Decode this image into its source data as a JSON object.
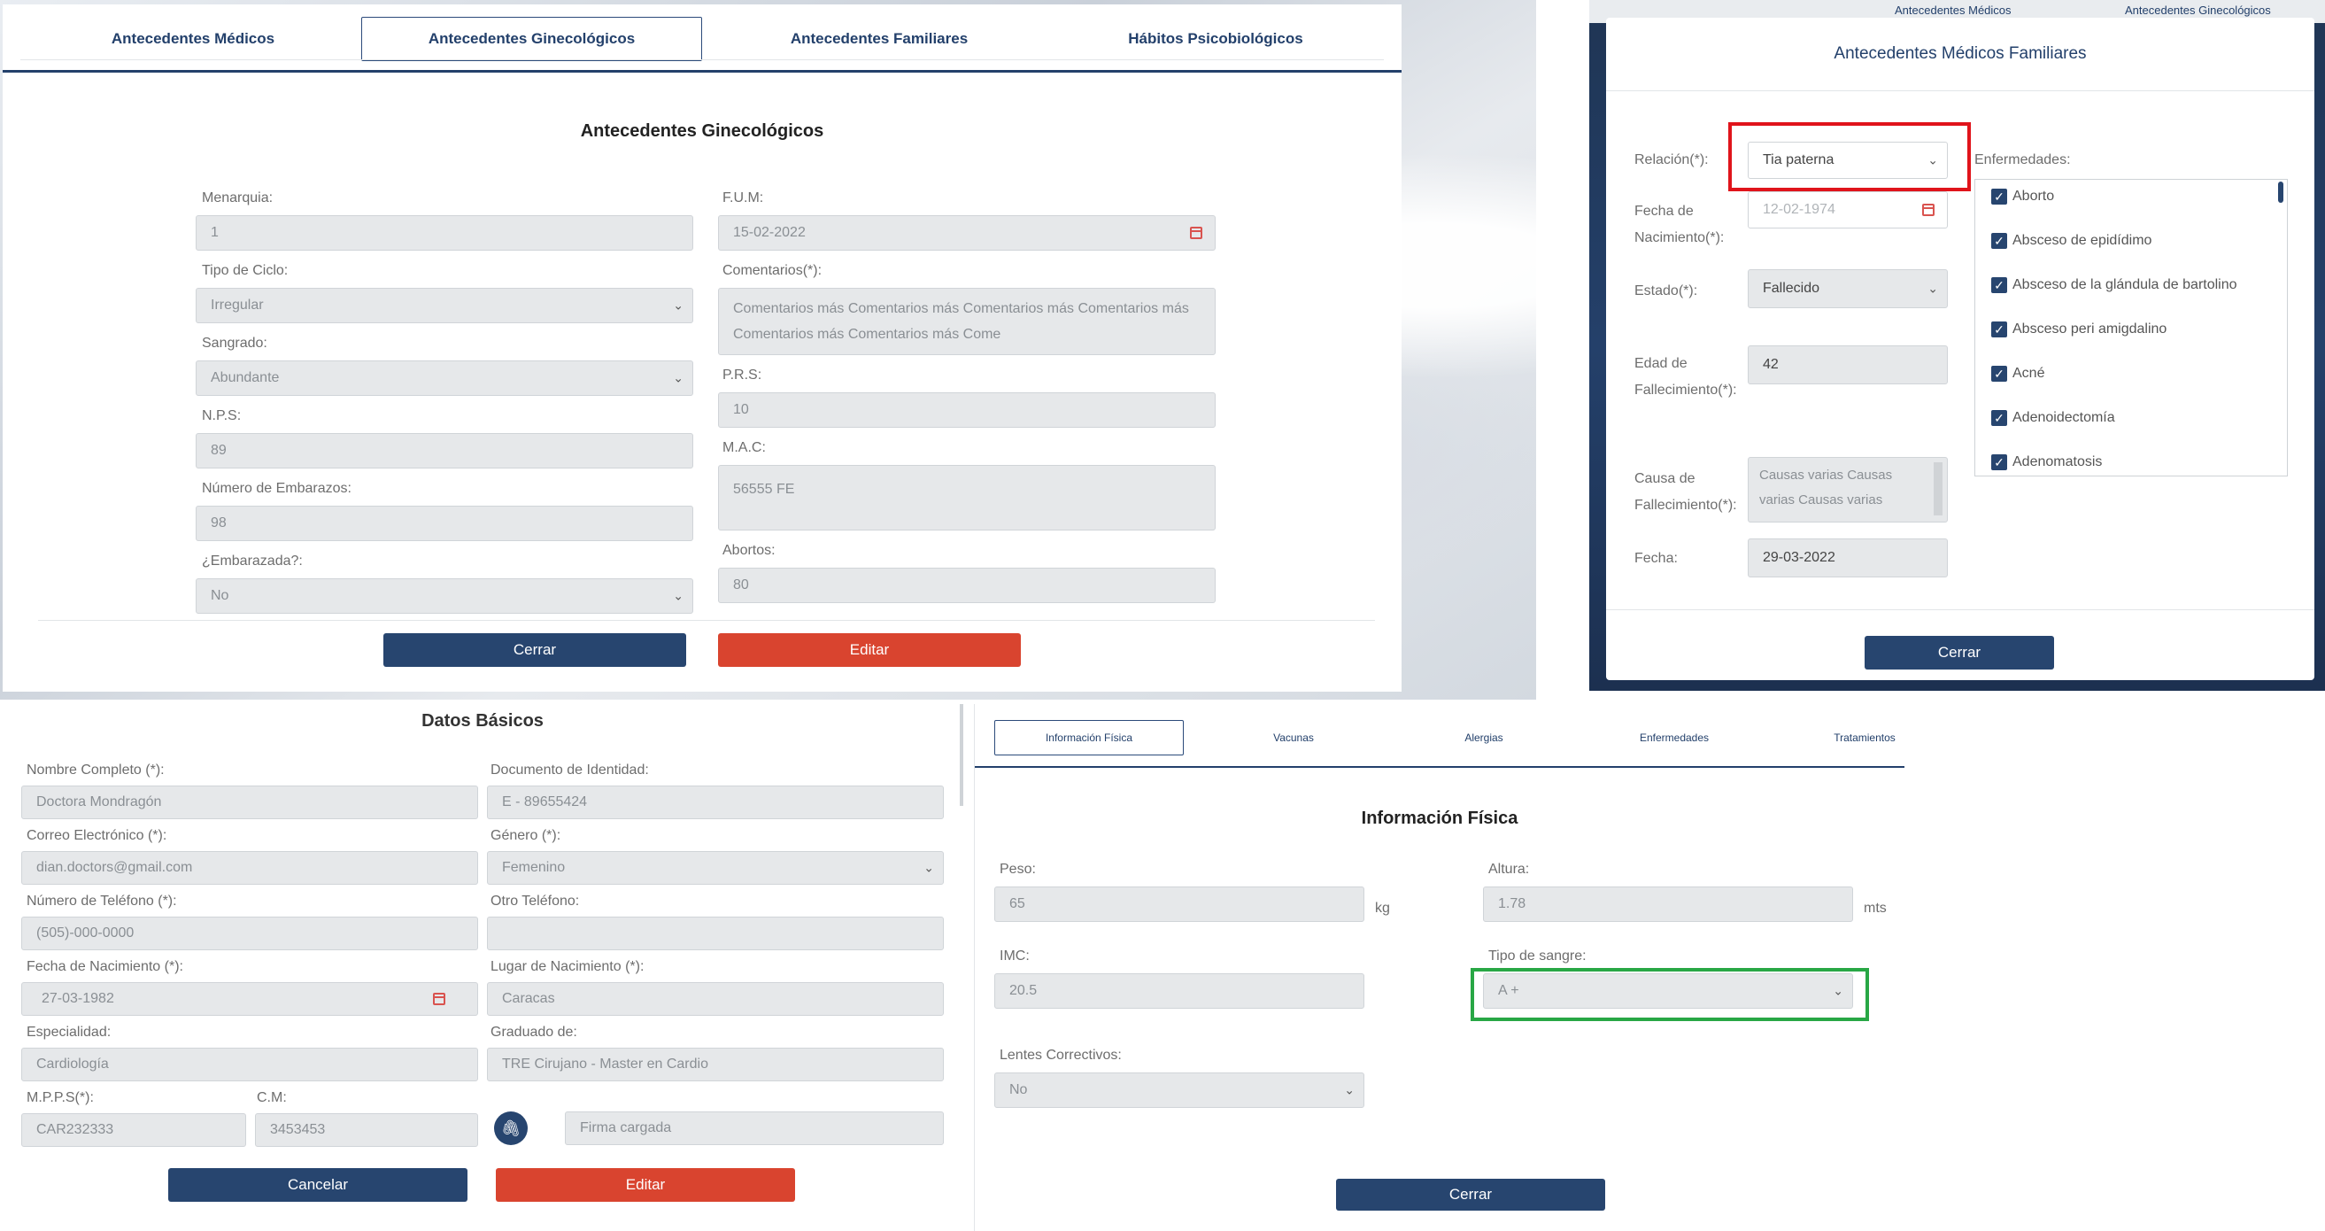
{
  "gyn": {
    "tabs": [
      "Antecedentes Médicos",
      "Antecedentes Ginecológicos",
      "Antecedentes Familiares",
      "Hábitos Psicobiológicos"
    ],
    "title": "Antecedentes Ginecológicos",
    "menarquia": {
      "label": "Menarquia:",
      "value": "1"
    },
    "fum": {
      "label": "F.U.M:",
      "value": "15-02-2022"
    },
    "tipo_ciclo": {
      "label": "Tipo de Ciclo:",
      "value": "Irregular"
    },
    "comentarios": {
      "label": "Comentarios(*):",
      "value": "Comentarios más Comentarios más Comentarios más Comentarios más Comentarios más Comentarios más Come"
    },
    "sangrado": {
      "label": "Sangrado:",
      "value": "Abundante"
    },
    "prs": {
      "label": "P.R.S:",
      "value": "10"
    },
    "nps": {
      "label": "N.P.S:",
      "value": "89"
    },
    "mac": {
      "label": "M.A.C:",
      "value": "56555 FE"
    },
    "num_embarazos": {
      "label": "Número de Embarazos:",
      "value": "98"
    },
    "abortos": {
      "label": "Abortos:",
      "value": "80"
    },
    "embarazada": {
      "label": "¿Embarazada?:",
      "value": "No"
    },
    "cerrar": "Cerrar",
    "editar": "Editar"
  },
  "fam": {
    "title": "Antecedentes Médicos Familiares",
    "bg_tabs": [
      "Antecedentes Médicos",
      "Antecedentes Ginecológicos"
    ],
    "relacion": {
      "label": "Relación(*):",
      "value": "Tia paterna"
    },
    "fecha_nac": {
      "label1": "Fecha de",
      "label2": "Nacimiento(*):",
      "value": "12-02-1974"
    },
    "estado": {
      "label": "Estado(*):",
      "value": "Fallecido"
    },
    "edad": {
      "label1": "Edad de",
      "label2": "Fallecimiento(*):",
      "value": "42"
    },
    "causa": {
      "label1": "Causa de",
      "label2": "Fallecimiento(*):",
      "value": "Causas varias Causas varias Causas varias"
    },
    "fecha": {
      "label": "Fecha:",
      "value": "29-03-2022"
    },
    "enfermedades_label": "Enfermedades:",
    "enfermedades": [
      "Aborto",
      "Absceso de epidídimo",
      "Absceso de la glándula de bartolino",
      "Absceso peri amigdalino",
      "Acné",
      "Adenoidectomía",
      "Adenomatosis"
    ],
    "cerrar": "Cerrar"
  },
  "basic": {
    "title": "Datos Básicos",
    "nombre": {
      "label": "Nombre Completo (*):",
      "value": "Doctora Mondragón"
    },
    "documento": {
      "label": "Documento de Identidad:",
      "value": "E - 89655424"
    },
    "correo": {
      "label": "Correo Electrónico (*):",
      "value": "dian.doctors@gmail.com"
    },
    "genero": {
      "label": "Género (*):",
      "value": "Femenino"
    },
    "telefono": {
      "label": "Número de Teléfono (*):",
      "value": "(505)-000-0000"
    },
    "otro_tel": {
      "label": "Otro Teléfono:",
      "value": ""
    },
    "fecha_nac": {
      "label": "Fecha de Nacimiento (*):",
      "value": "27-03-1982"
    },
    "lugar_nac": {
      "label": "Lugar de Nacimiento (*):",
      "value": "Caracas"
    },
    "especialidad": {
      "label": "Especialidad:",
      "value": "Cardiología"
    },
    "graduado": {
      "label": "Graduado de:",
      "value": "TRE Cirujano - Master en Cardio"
    },
    "mpps": {
      "label": "M.P.P.S(*):",
      "value": "CAR232333"
    },
    "cm": {
      "label": "C.M:",
      "value": "3453453"
    },
    "firma": {
      "placeholder": "Firma cargada"
    },
    "cancelar": "Cancelar",
    "editar": "Editar"
  },
  "phys": {
    "tabs": [
      "Información Física",
      "Vacunas",
      "Alergias",
      "Enfermedades",
      "Tratamientos"
    ],
    "title": "Información Física",
    "peso": {
      "label": "Peso:",
      "value": "65",
      "unit": "kg"
    },
    "altura": {
      "label": "Altura:",
      "value": "1.78",
      "unit": "mts"
    },
    "imc": {
      "label": "IMC:",
      "value": "20.5"
    },
    "tipo_sangre": {
      "label": "Tipo de sangre:",
      "value": "A +"
    },
    "lentes": {
      "label": "Lentes Correctivos:",
      "value": "No"
    },
    "cerrar": "Cerrar"
  },
  "colors": {
    "navy": "#27456f",
    "red_button": "#d9442f",
    "highlight_red": "#e0141b",
    "highlight_green": "#28a745"
  }
}
